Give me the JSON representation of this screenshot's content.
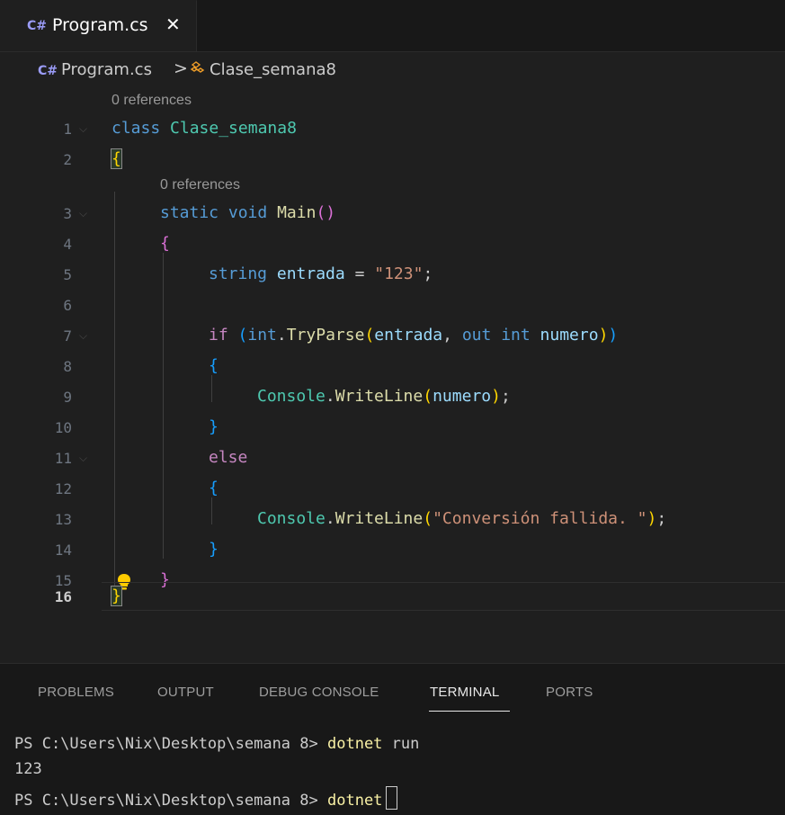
{
  "tabs": [
    {
      "label": "Program.cs",
      "close": "✕"
    }
  ],
  "breadcrumb": {
    "file": "Program.cs",
    "separator": ">",
    "symbol": "Clase_semana8"
  },
  "editor": {
    "codelens": [
      "0 references",
      "0 references"
    ],
    "line_numbers": [
      "1",
      "2",
      "3",
      "4",
      "5",
      "6",
      "7",
      "8",
      "9",
      "10",
      "11",
      "12",
      "13",
      "14",
      "15",
      "16"
    ],
    "active_line": "16",
    "tokens": {
      "l1_kw": "class",
      "l1_name": "Clase_semana8",
      "l2_brace": "{",
      "l3_static": "static",
      "l3_void": "void",
      "l3_main": "Main",
      "l3_paren": "()",
      "l4_brace": "{",
      "l5_string_kw": "string",
      "l5_var": "entrada",
      "l5_eq": " = ",
      "l5_str": "\"123\"",
      "l5_semi": ";",
      "l7_if": "if",
      "l7_open": "(",
      "l7_int": "int",
      "l7_dot": ".",
      "l7_tryparse": "TryParse",
      "l7_open2": "(",
      "l7_arg": "entrada",
      "l7_comma": ", ",
      "l7_out": "out",
      "l7_int2": "int",
      "l7_numero": "numero",
      "l7_close2": ")",
      "l7_close": ")",
      "l8_brace": "{",
      "l9_console": "Console",
      "l9_dot": ".",
      "l9_writeline": "WriteLine",
      "l9_open": "(",
      "l9_arg": "numero",
      "l9_close": ")",
      "l9_semi": ";",
      "l10_brace": "}",
      "l11_else": "else",
      "l12_brace": "{",
      "l13_console": "Console",
      "l13_dot": ".",
      "l13_writeline": "WriteLine",
      "l13_open": "(",
      "l13_str": "\"Conversión fallida. \"",
      "l13_close": ")",
      "l13_semi": ";",
      "l14_brace": "}",
      "l15_brace": "}",
      "l16_brace": "}"
    }
  },
  "panel": {
    "tabs": [
      "PROBLEMS",
      "OUTPUT",
      "DEBUG CONSOLE",
      "TERMINAL",
      "PORTS"
    ],
    "active_tab": "TERMINAL",
    "terminal": {
      "line1_prompt": "PS C:\\Users\\Nix\\Desktop\\semana 8> ",
      "line1_cmd": "dotnet",
      "line1_rest": " run",
      "line2": "123",
      "line3_prompt": "PS C:\\Users\\Nix\\Desktop\\semana 8> ",
      "line3_cmd": "dotnet"
    }
  },
  "icons": {
    "file_icon": "csharp-icon",
    "class_icon": "class-symbol-icon",
    "lightbulb": "lightbulb-icon"
  },
  "colors": {
    "background": "#1f1f1f",
    "keyword": "#569cd6",
    "type": "#4ec9b0",
    "function": "#dcdcaa",
    "string": "#ce9178",
    "variable": "#9cdcfe",
    "control": "#c586c0",
    "bracket1": "#ffd700",
    "bracket2": "#da70d6",
    "bracket3": "#179fff"
  }
}
